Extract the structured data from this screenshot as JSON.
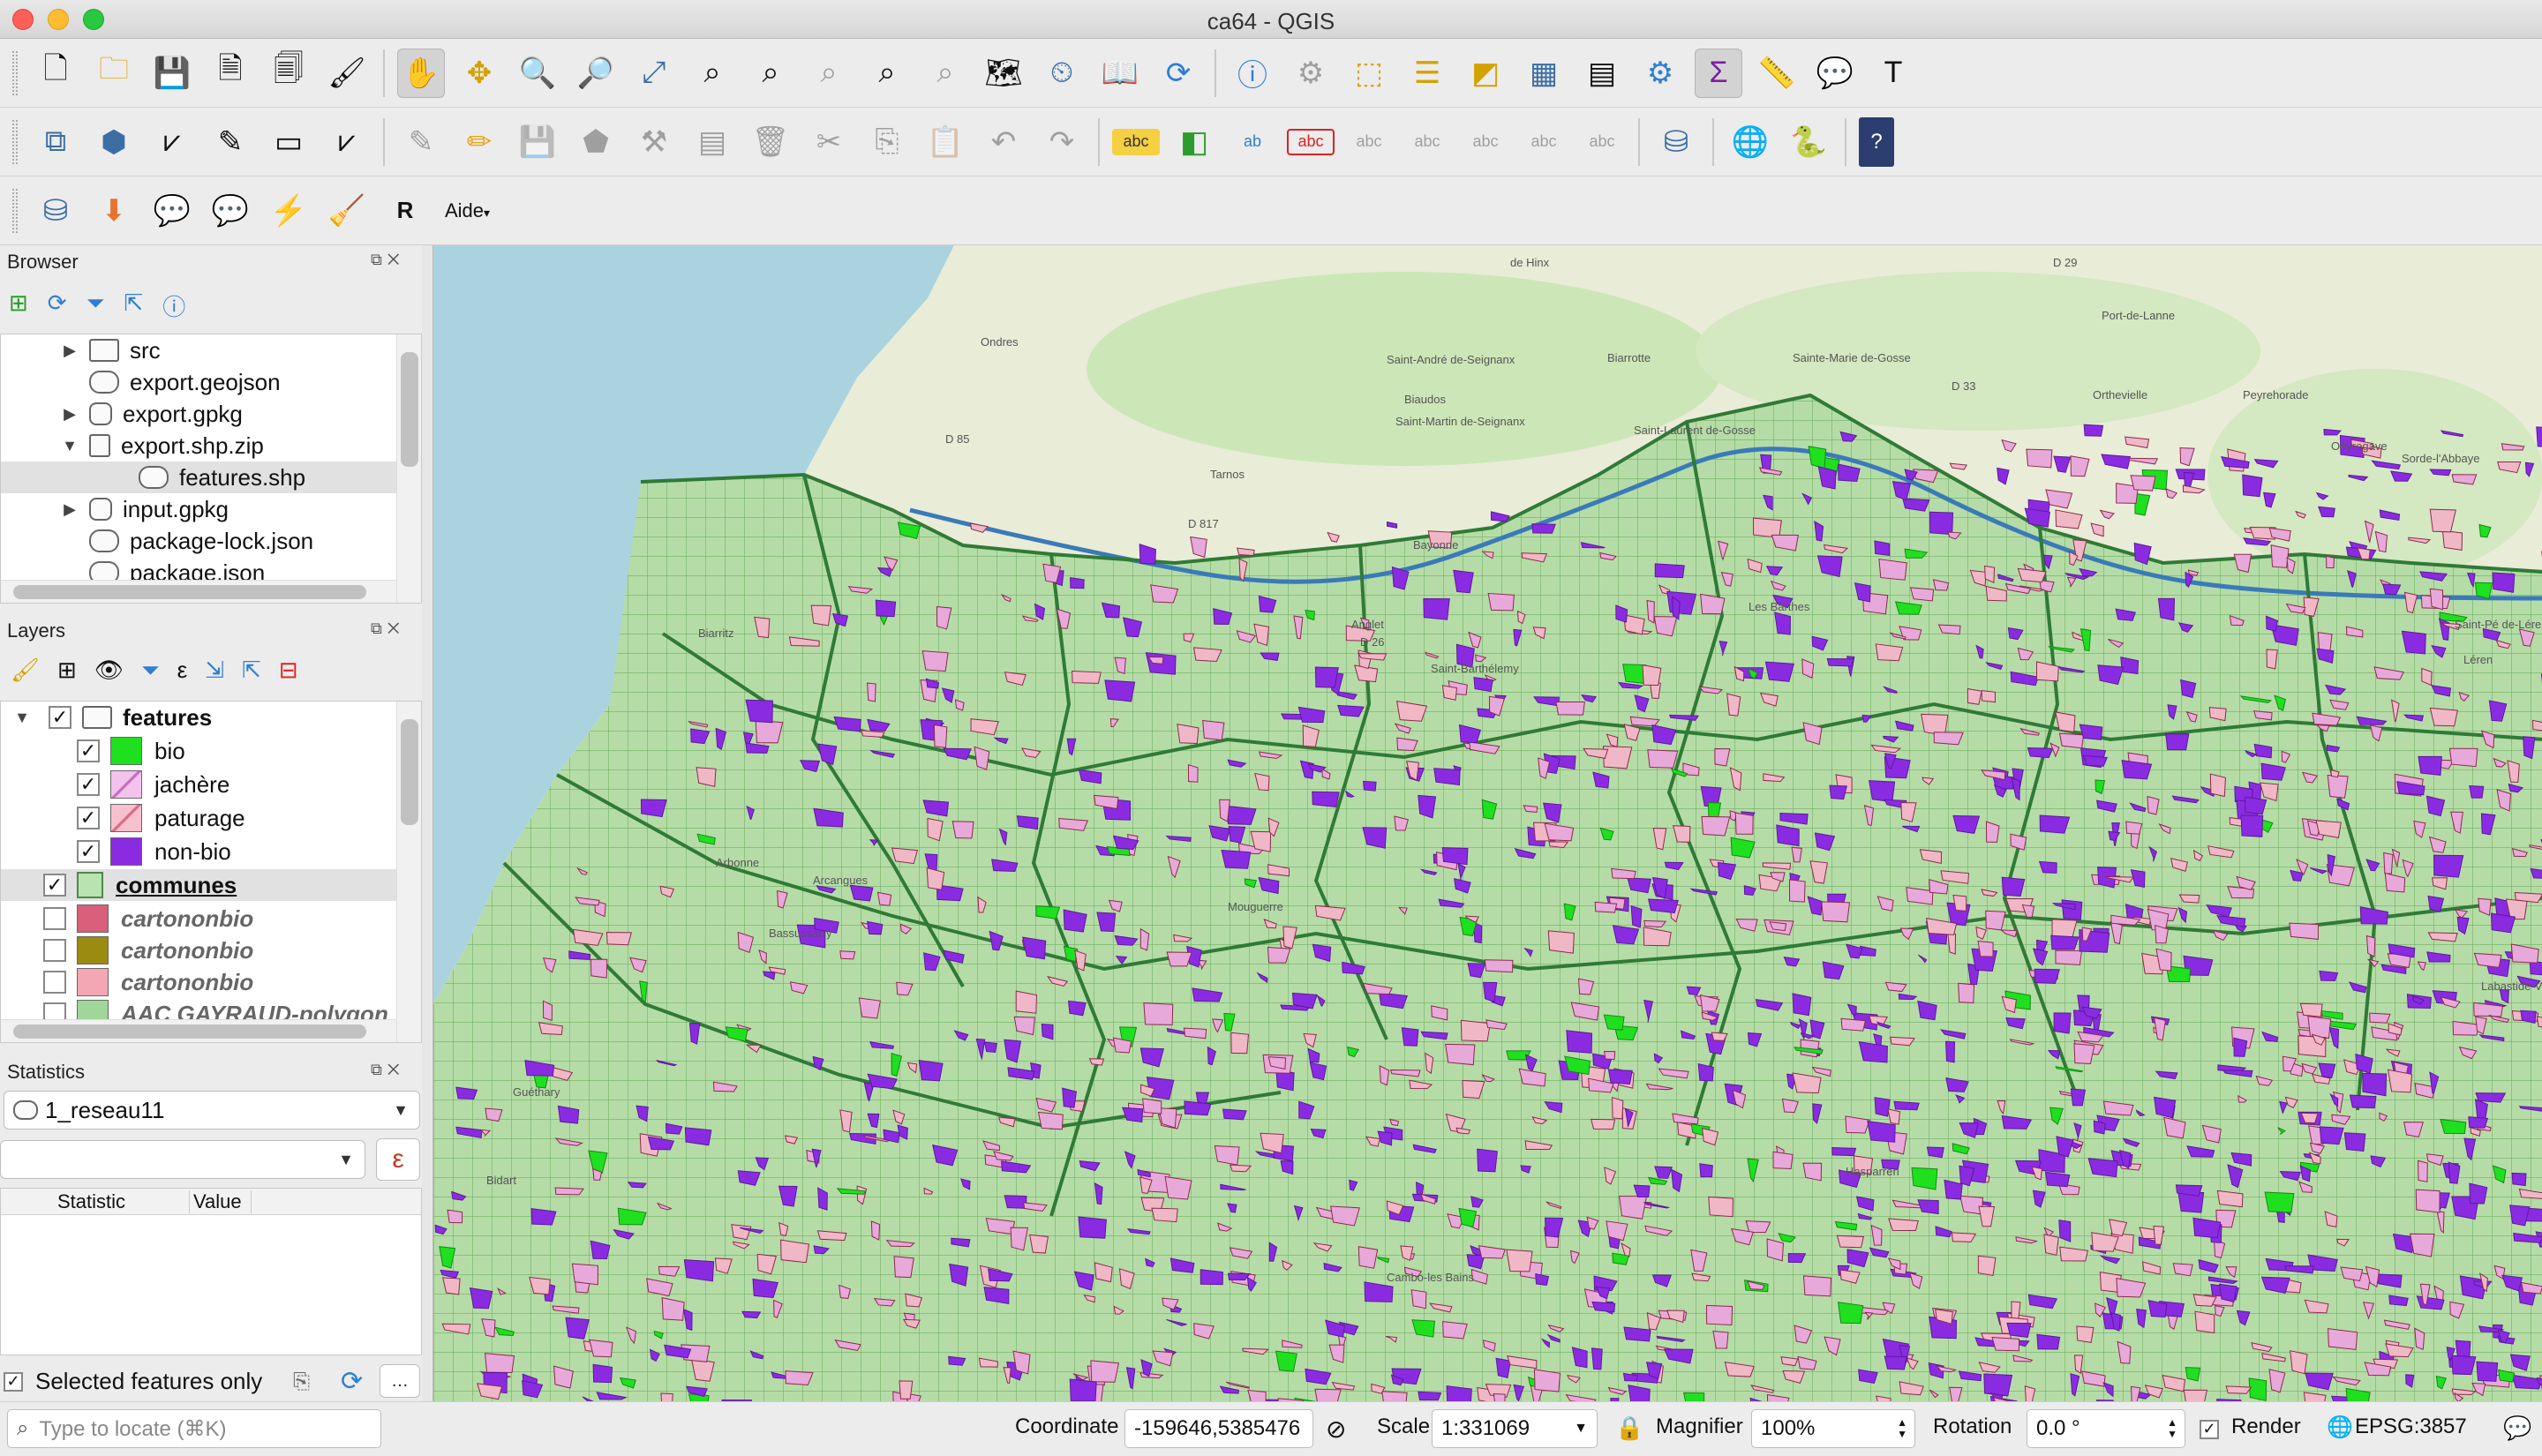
{
  "window": {
    "title": "ca64 - QGIS"
  },
  "toolbar3": {
    "aide_label": "Aide"
  },
  "browser": {
    "title": "Browser",
    "items": [
      {
        "label": "src",
        "icon": "folder-icon",
        "arrow": "▶"
      },
      {
        "label": "export.geojson",
        "icon": "vector-file-icon",
        "arrow": ""
      },
      {
        "label": "export.gpkg",
        "icon": "geopackage-icon",
        "arrow": "▶"
      },
      {
        "label": "export.shp.zip",
        "icon": "zip-icon",
        "arrow": "▼"
      },
      {
        "label": "features.shp",
        "icon": "vector-file-icon",
        "arrow": ""
      },
      {
        "label": "input.gpkg",
        "icon": "geopackage-icon",
        "arrow": "▶"
      },
      {
        "label": "package-lock.json",
        "icon": "vector-file-icon",
        "arrow": ""
      },
      {
        "label": "package.json",
        "icon": "vector-file-icon",
        "arrow": ""
      }
    ]
  },
  "layers": {
    "title": "Layers",
    "items": [
      {
        "label": "features",
        "checked": true,
        "color": ""
      },
      {
        "label": "bio",
        "checked": true,
        "color": "#1fe01f"
      },
      {
        "label": "jachère",
        "checked": true,
        "color": "#d77fd0"
      },
      {
        "label": "paturage",
        "checked": true,
        "color": "#f2a6c0"
      },
      {
        "label": "non-bio",
        "checked": true,
        "color": "#8a2be2"
      },
      {
        "label": "communes",
        "checked": true,
        "color": "#b9e3b0"
      },
      {
        "label": "cartononbio",
        "checked": false,
        "color": "#d9607a"
      },
      {
        "label": "cartononbio",
        "checked": false,
        "color": "#9c8b11"
      },
      {
        "label": "cartononbio",
        "checked": false,
        "color": "#f3a7b5"
      },
      {
        "label": "AAC GAYRAUD-polygon",
        "checked": false,
        "color": "#9fd79a"
      }
    ]
  },
  "statistics": {
    "title": "Statistics",
    "layer": "1_reseau11",
    "field": "",
    "col_statistic": "Statistic",
    "col_value": "Value",
    "selected_only_label": "Selected features only"
  },
  "status": {
    "locate_placeholder": "Type to locate (⌘K)",
    "coordinate_label": "Coordinate",
    "coordinate_value": "-159646,5385476",
    "scale_label": "Scale",
    "scale_value": "1:331069",
    "magnifier_label": "Magnifier",
    "magnifier_value": "100%",
    "rotation_label": "Rotation",
    "rotation_value": "0.0 °",
    "render_label": "Render",
    "crs_label": "EPSG:3857"
  },
  "map_labels": [
    "de Hinx",
    "Ondres",
    "Saint-André de-Seignanx",
    "Biarrotte",
    "Sainte-Marie de-Gosse",
    "Port-de-Lanne",
    "Biaudos",
    "Orthevielle",
    "Peyrehorade",
    "Tarnos",
    "Saint-Martin de-Seignanx",
    "Saint-Laurent de-Gosse",
    "Oeyregave",
    "Sorde-l'Abbaye",
    "Bayonne",
    "Anglet",
    "Biarritz",
    "Saint-Barthélemy",
    "Les Barthes",
    "Labastide-Ville",
    "Saint-Pé de-Léren",
    "Léren",
    "Arbonne",
    "Arcangues",
    "Bassussarry",
    "Mouguerre",
    "Hasparren",
    "Cambo-les Bains",
    "Guéthary",
    "Bidart",
    "D 85",
    "D 817",
    "D 26",
    "D 33",
    "D 29"
  ]
}
